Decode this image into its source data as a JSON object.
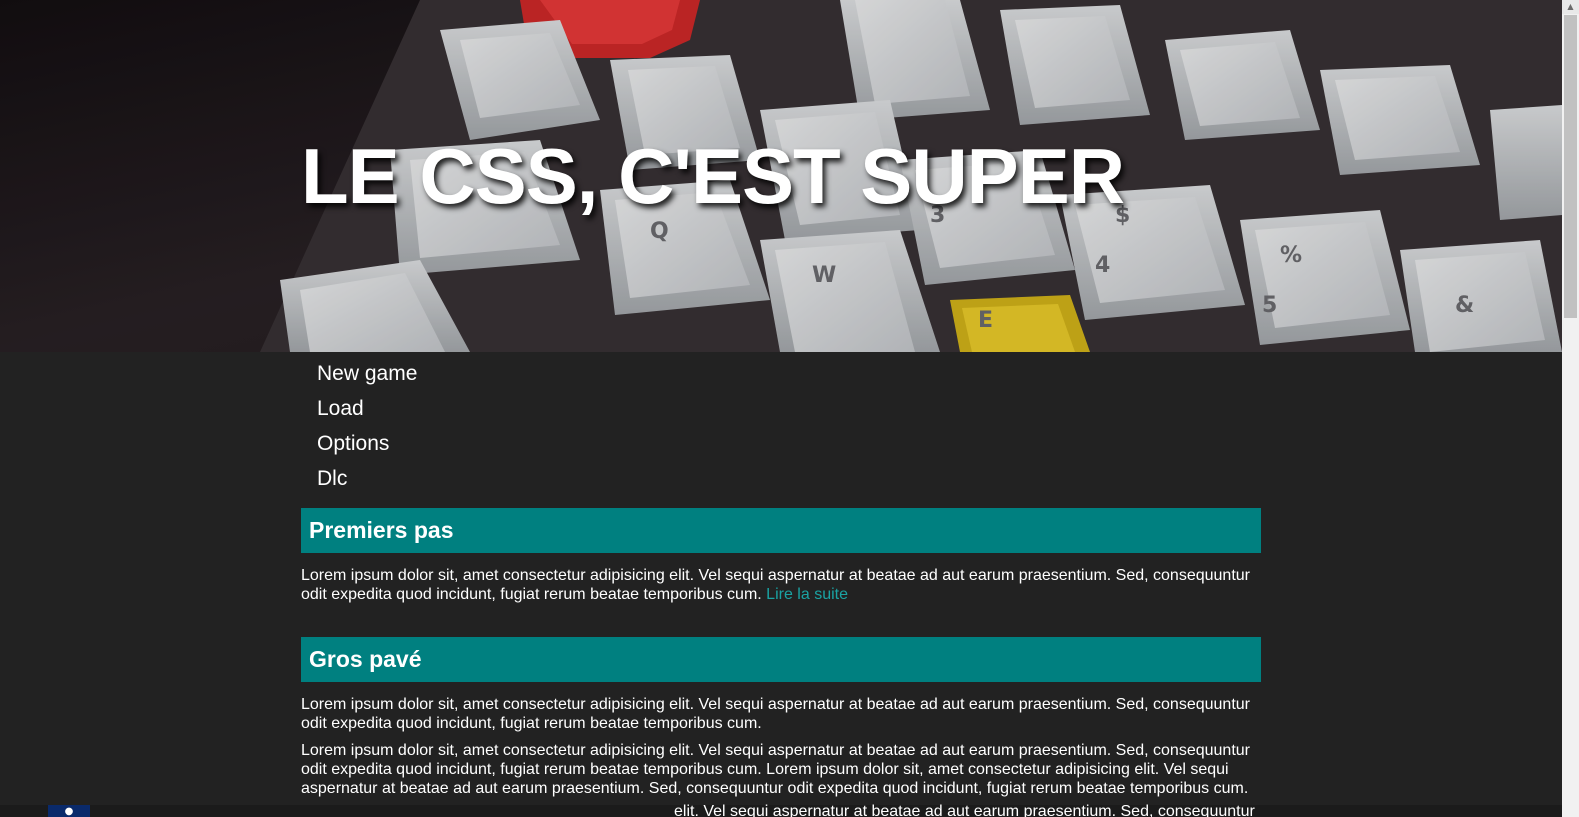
{
  "hero": {
    "title": "LE CSS, C'EST SUPER"
  },
  "menu": {
    "items": [
      "New game",
      "Load",
      "Options",
      "Dlc"
    ]
  },
  "sections": [
    {
      "heading": "Premiers pas",
      "paragraphs": [
        "Lorem ipsum dolor sit, amet consectetur adipisicing elit. Vel sequi aspernatur at beatae ad aut earum praesentium. Sed, consequuntur odit expedita quod incidunt, fugiat rerum beatae temporibus cum."
      ],
      "link": "Lire la suite"
    },
    {
      "heading": "Gros pavé",
      "paragraphs": [
        "Lorem ipsum dolor sit, amet consectetur adipisicing elit. Vel sequi aspernatur at beatae ad aut earum praesentium. Sed, consequuntur odit expedita quod incidunt, fugiat rerum beatae temporibus cum.",
        "Lorem ipsum dolor sit, amet consectetur adipisicing elit. Vel sequi aspernatur at beatae ad aut earum praesentium. Sed, consequuntur odit expedita quod incidunt, fugiat rerum beatae temporibus cum. Lorem ipsum dolor sit, amet consectetur adipisicing elit. Vel sequi aspernatur at beatae ad aut earum praesentium. Sed, consequuntur odit expedita quod incidunt, fugiat rerum beatae temporibus cum."
      ]
    }
  ],
  "overflow_text": "elit. Vel sequi aspernatur at beatae ad aut earum praesentium. Sed, consequuntur",
  "colors": {
    "page_background": "#222222",
    "heading_background": "#008080",
    "link": "#1aa3a3",
    "text": "#ffffff"
  },
  "icons": {
    "scroll_up": "chevron-up-icon",
    "bottom_tab": "blue-tab-icon"
  }
}
